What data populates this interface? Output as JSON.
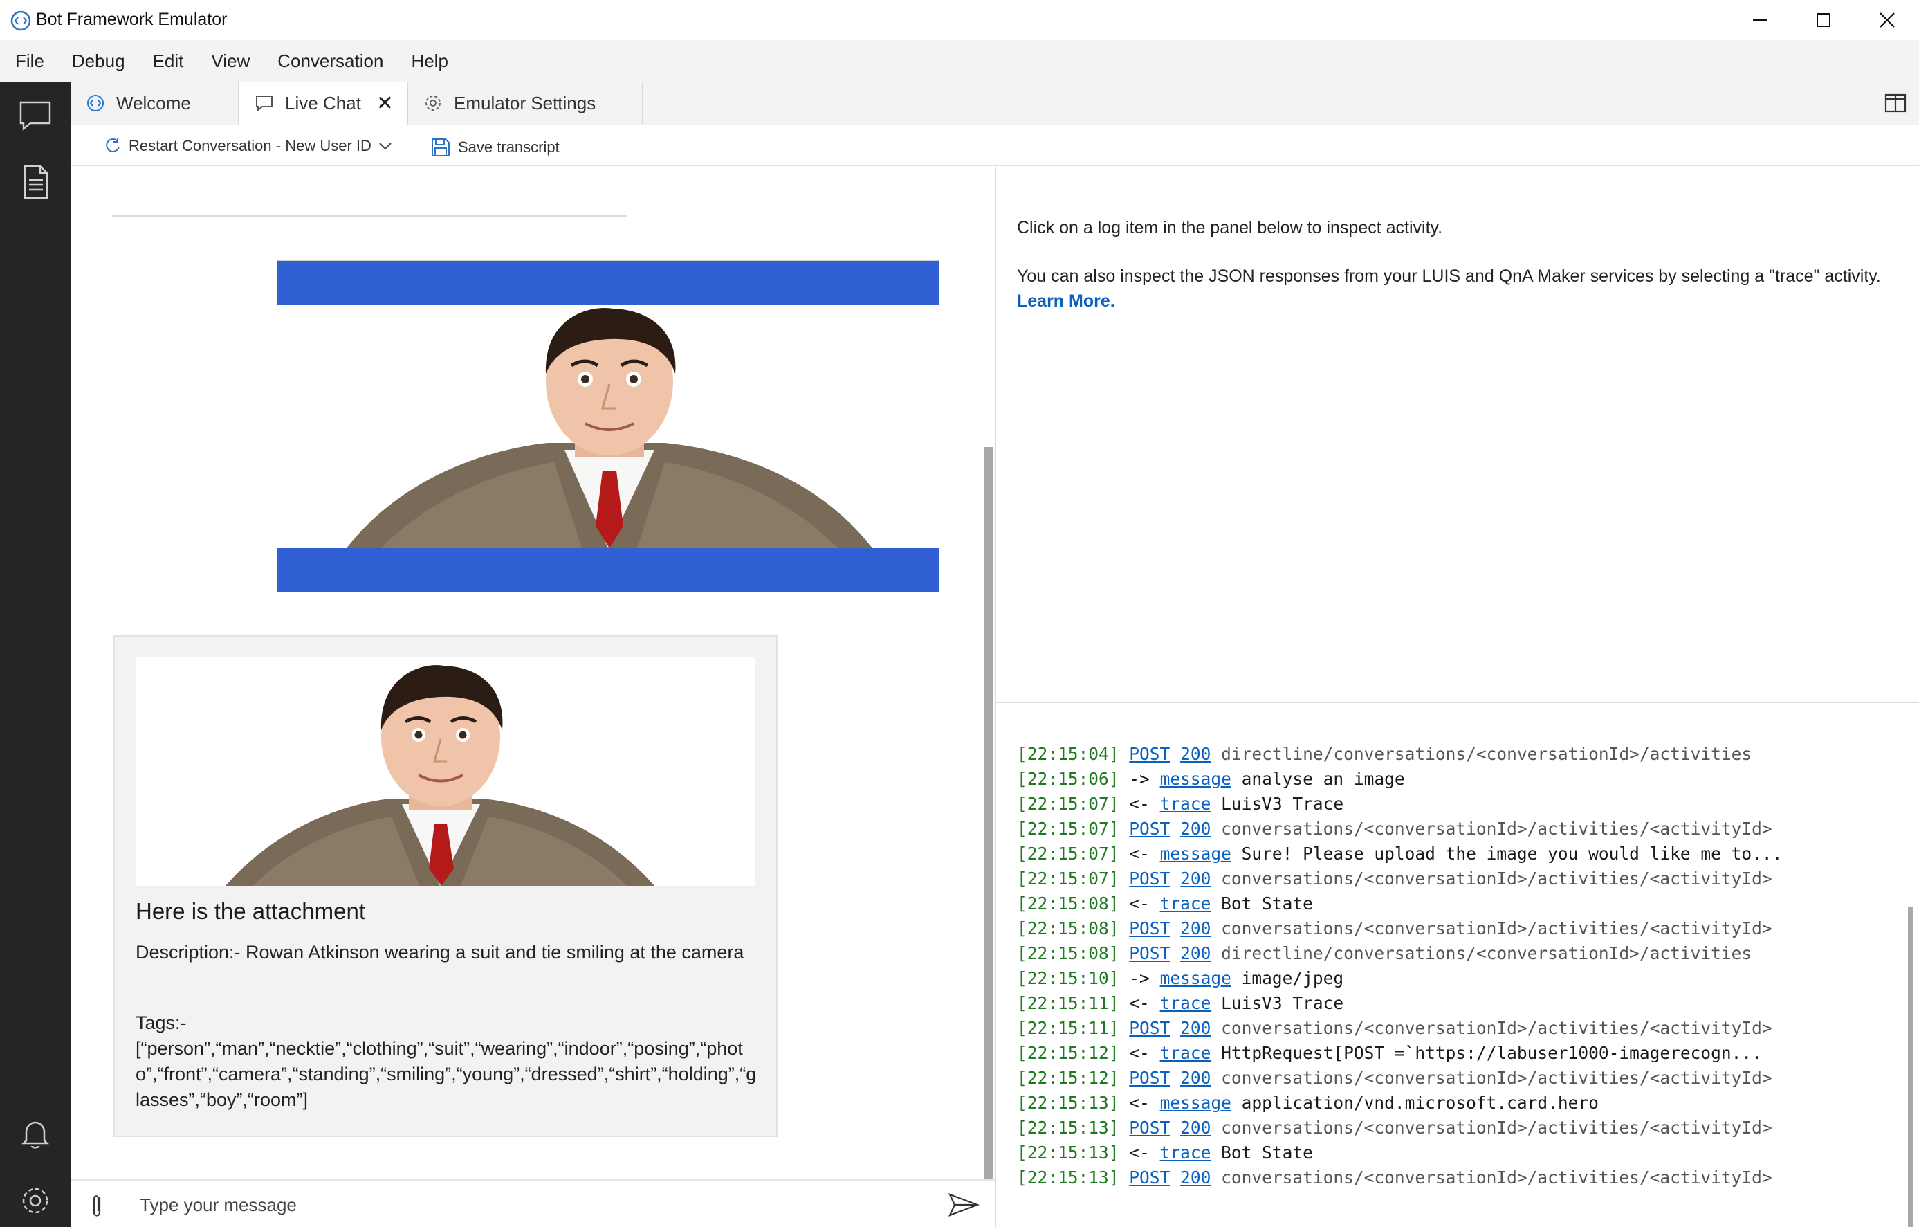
{
  "window": {
    "title": "Bot Framework Emulator"
  },
  "menu": [
    "File",
    "Debug",
    "Edit",
    "View",
    "Conversation",
    "Help"
  ],
  "tabs": [
    {
      "label": "Welcome",
      "icon": "bot-emulator-icon"
    },
    {
      "label": "Live Chat",
      "icon": "chat-bubble-icon",
      "active": true,
      "closable": true
    },
    {
      "label": "Emulator Settings",
      "icon": "gear-icon"
    }
  ],
  "toolbar": {
    "restart_label": "Restart Conversation - New User ID",
    "save_label": "Save transcript"
  },
  "chat": {
    "user_attachment": {
      "band_color": "#3060d4"
    },
    "bot_card": {
      "title": "Here is the attachment",
      "description": "Description:- Rowan Atkinson wearing a suit and tie smiling at the camera",
      "tags_label": "Tags:-",
      "tags_value": "[“person”,“man”,“necktie”,“clothing”,“suit”,“wearing”,“indoor”,“posing”,“photo”,“front”,“camera”,“standing”,“smiling”,“young”,“dressed”,“shirt”,“holding”,“glasses”,“boy”,“room”]"
    },
    "composer_placeholder": "Type your message"
  },
  "inspector": {
    "line1": "Click on a log item in the panel below to inspect activity.",
    "line2": "You can also inspect the JSON responses from your LUIS and QnA Maker services by selecting a \"trace\" activity.",
    "learn_more": "Learn More."
  },
  "log": [
    {
      "ts": "[22:15:04]",
      "kind": "POST",
      "code": "200",
      "text": "directline/conversations/<conversationId>/activities"
    },
    {
      "ts": "[22:15:06]",
      "dir": "->",
      "kind": "message",
      "text": "analyse an image"
    },
    {
      "ts": "[22:15:07]",
      "dir": "<-",
      "kind": "trace",
      "text": "LuisV3 Trace"
    },
    {
      "ts": "[22:15:07]",
      "kind": "POST",
      "code": "200",
      "text": "conversations/<conversationId>/activities/<activityId>"
    },
    {
      "ts": "[22:15:07]",
      "dir": "<-",
      "kind": "message",
      "text": "Sure! Please upload the image you would like me to..."
    },
    {
      "ts": "[22:15:07]",
      "kind": "POST",
      "code": "200",
      "text": "conversations/<conversationId>/activities/<activityId>"
    },
    {
      "ts": "[22:15:08]",
      "dir": "<-",
      "kind": "trace",
      "text": "Bot State"
    },
    {
      "ts": "[22:15:08]",
      "kind": "POST",
      "code": "200",
      "text": "conversations/<conversationId>/activities/<activityId>"
    },
    {
      "ts": "[22:15:08]",
      "kind": "POST",
      "code": "200",
      "text": "directline/conversations/<conversationId>/activities"
    },
    {
      "ts": "[22:15:10]",
      "dir": "->",
      "kind": "message",
      "text": "image/jpeg"
    },
    {
      "ts": "[22:15:11]",
      "dir": "<-",
      "kind": "trace",
      "text": "LuisV3 Trace"
    },
    {
      "ts": "[22:15:11]",
      "kind": "POST",
      "code": "200",
      "text": "conversations/<conversationId>/activities/<activityId>"
    },
    {
      "ts": "[22:15:12]",
      "dir": "<-",
      "kind": "trace",
      "text": "HttpRequest[POST =`https://labuser1000-imagerecogn..."
    },
    {
      "ts": "[22:15:12]",
      "kind": "POST",
      "code": "200",
      "text": "conversations/<conversationId>/activities/<activityId>"
    },
    {
      "ts": "[22:15:13]",
      "dir": "<-",
      "kind": "message",
      "text": "application/vnd.microsoft.card.hero"
    },
    {
      "ts": "[22:15:13]",
      "kind": "POST",
      "code": "200",
      "text": "conversations/<conversationId>/activities/<activityId>"
    },
    {
      "ts": "[22:15:13]",
      "dir": "<-",
      "kind": "trace",
      "text": "Bot State"
    },
    {
      "ts": "[22:15:13]",
      "kind": "POST",
      "code": "200",
      "text": "conversations/<conversationId>/activities/<activityId>"
    }
  ]
}
